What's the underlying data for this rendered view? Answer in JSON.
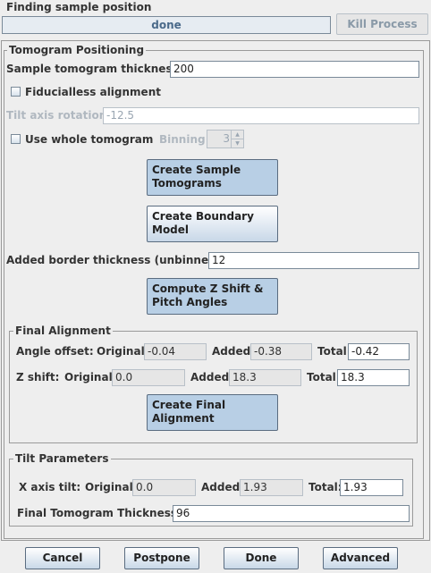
{
  "status": {
    "title": "Finding sample position",
    "progress_text": "done",
    "kill_label": "Kill Process"
  },
  "positioning": {
    "group_title": "Tomogram Positioning",
    "sample_thickness_label": "Sample tomogram thickness:",
    "sample_thickness_value": "200",
    "fiducialless_label": "Fiducialless alignment",
    "fiducialless_checked": false,
    "tilt_axis_label": "Tilt axis rotation:",
    "tilt_axis_value": "-12.5",
    "whole_tomogram_label": "Use whole tomogram",
    "whole_tomogram_checked": false,
    "binning_label": "Binning",
    "binning_value": "3",
    "create_sample_label": "Create Sample\nTomograms",
    "create_boundary_label": "Create Boundary\nModel",
    "border_label": "Added border thickness (unbinned):",
    "border_value": "12",
    "compute_z_label": "Compute Z Shift &\nPitch Angles"
  },
  "final_alignment": {
    "group_title": "Final Alignment",
    "angle_offset_label": "Angle offset:",
    "original_label": "Original:",
    "added_label": "Added:",
    "total_label": "Total:",
    "angle_original": "-0.04",
    "angle_added": "-0.38",
    "angle_total": "-0.42",
    "z_shift_label": "Z shift:",
    "z_original": "0.0",
    "z_added": "18.3",
    "z_total": "18.3",
    "create_final_label": "Create Final\nAlignment"
  },
  "tilt_parameters": {
    "group_title": "Tilt Parameters",
    "x_axis_label": "X axis tilt:",
    "original_label": "Original:",
    "added_label": "Added:",
    "total_label": "Total:",
    "x_original": "0.0",
    "x_added": "1.93",
    "x_total": "1.93",
    "final_thickness_label": "Final Tomogram Thickness:",
    "final_thickness_value": "96"
  },
  "footer": {
    "cancel_label": "Cancel",
    "postpone_label": "Postpone",
    "done_label": "Done",
    "advanced_label": "Advanced"
  }
}
